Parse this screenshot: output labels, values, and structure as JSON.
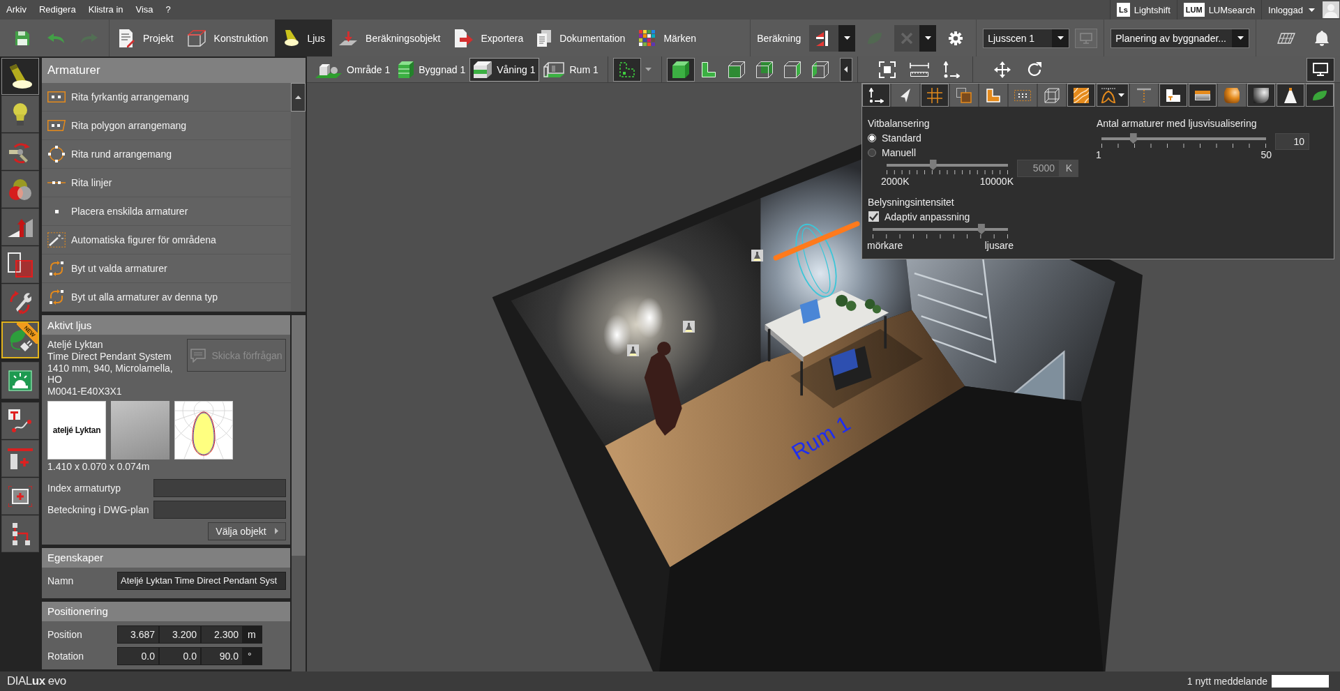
{
  "menu_bar": {
    "items": [
      "Arkiv",
      "Redigera",
      "Klistra in",
      "Visa",
      "?"
    ],
    "services": [
      {
        "logo": "Ls",
        "label": "Lightshift"
      },
      {
        "logo": "LUM",
        "label": "LUMsearch"
      }
    ],
    "account": "Inloggad"
  },
  "toolbar": {
    "quick_actions": [
      {
        "disabled": false
      },
      {
        "disabled": false
      },
      {
        "disabled": true
      }
    ],
    "tabs": [
      {
        "label": "Projekt",
        "selected": false
      },
      {
        "label": "Konstruktion",
        "selected": false
      },
      {
        "label": "Ljus",
        "selected": true
      },
      {
        "label": "Beräkningsobjekt",
        "selected": false
      },
      {
        "label": "Exportera",
        "selected": false
      },
      {
        "label": "Dokumentation",
        "selected": false
      },
      {
        "label": "Märken",
        "selected": false
      }
    ],
    "calculation": {
      "label": "Beräkning",
      "buttons": [
        {
          "disabled": false,
          "dropdown": true
        },
        {
          "disabled": true,
          "dropdown": false
        },
        {
          "disabled": true,
          "dropdown": true
        },
        {
          "disabled": false,
          "dropdown": false
        }
      ]
    },
    "light_scene": {
      "value": "Ljusscen 1",
      "preview_button": {
        "disabled": true
      }
    },
    "workflow": {
      "value": "Planering av byggnader..."
    }
  },
  "side_rail": {
    "groups": [
      {
        "items": [
          {
            "selected": true,
            "highlighted": false
          },
          {
            "selected": false,
            "highlighted": false
          },
          {
            "selected": false,
            "highlighted": false
          },
          {
            "selected": false,
            "highlighted": false
          },
          {
            "selected": false,
            "highlighted": false
          },
          {
            "selected": false,
            "highlighted": false
          },
          {
            "selected": false,
            "highlighted": false
          },
          {
            "selected": false,
            "highlighted": true,
            "badge": "NEW"
          }
        ]
      },
      {
        "items": [
          {
            "selected": false,
            "highlighted": false
          }
        ]
      },
      {
        "items": [
          {
            "selected": false,
            "highlighted": false
          },
          {
            "selected": false,
            "highlighted": false
          },
          {
            "selected": false,
            "highlighted": false
          },
          {
            "selected": false,
            "highlighted": false
          }
        ]
      }
    ]
  },
  "luminaires": {
    "title": "Armaturer",
    "tools": [
      "Rita fyrkantig arrangemang",
      "Rita polygon arrangemang",
      "Rita rund arrangemang",
      "Rita linjer",
      "Placera enskilda armaturer",
      "Automatiska figurer för områdena",
      "Byt ut valda armaturer",
      "Byt ut alla armaturer av denna typ"
    ]
  },
  "active_light": {
    "title": "Aktivt ljus",
    "manufacturer": "Ateljé Lyktan",
    "product": "Time Direct Pendant System",
    "variant": "1410 mm, 940, Microlamella, HO",
    "article": "M0041-E40X3X1",
    "request_button": {
      "label": "Skicka förfrågan",
      "disabled": true
    },
    "brand_logo": "ateljé Lyktan",
    "dimensions": "1.410 x 0.070 x 0.074m",
    "fields": [
      {
        "label": "Index armaturtyp"
      },
      {
        "label": "Beteckning i DWG-plan"
      }
    ],
    "select_button": "Välja objekt"
  },
  "properties": {
    "title": "Egenskaper",
    "fields": [
      {
        "label": "Namn",
        "value": "Ateljé Lyktan Time Direct Pendant Syst"
      }
    ]
  },
  "positioning": {
    "title": "Positionering",
    "rows": [
      {
        "label": "Position",
        "values": [
          "3.687",
          "3.200",
          "2.300"
        ],
        "unit": "m"
      },
      {
        "label": "Rotation",
        "values": [
          "0.0",
          "0.0",
          "90.0"
        ],
        "unit": "°"
      }
    ]
  },
  "view_toolbar": {
    "breadcrumb": [
      {
        "label": "Område 1",
        "selected": false
      },
      {
        "label": "Byggnad 1",
        "selected": false
      },
      {
        "label": "Våning 1",
        "selected": true
      },
      {
        "label": "Rum 1",
        "selected": false
      }
    ],
    "plan_view": {
      "selected": true
    },
    "view_modes": [
      {
        "selected": true
      },
      {
        "selected": false
      },
      {
        "selected": false
      },
      {
        "selected": false
      },
      {
        "selected": false
      },
      {
        "selected": false
      }
    ],
    "display_button": {
      "selected": true
    }
  },
  "scene": {
    "room_label": "Rum 1"
  },
  "display_panel": {
    "toggles": [
      {
        "on": true,
        "dropdown": false
      },
      {
        "on": false,
        "dropdown": false
      },
      {
        "on": true,
        "dropdown": false
      },
      {
        "on": false,
        "dropdown": false
      },
      {
        "on": false,
        "dropdown": false
      },
      {
        "on": false,
        "dropdown": false
      },
      {
        "on": false,
        "dropdown": false
      },
      {
        "on": true,
        "dropdown": false
      },
      {
        "on": true,
        "dropdown": true
      },
      {
        "on": false,
        "dropdown": false
      },
      {
        "on": true,
        "dropdown": false
      },
      {
        "on": true,
        "dropdown": false
      },
      {
        "on": false,
        "dropdown": false
      },
      {
        "on": true,
        "dropdown": false
      },
      {
        "on": true,
        "dropdown": false
      },
      {
        "on": true,
        "dropdown": false
      }
    ],
    "white_balance": {
      "title": "Vitbalansering",
      "options": [
        {
          "label": "Standard",
          "selected": true
        },
        {
          "label": "Manuell",
          "selected": false
        }
      ],
      "slider": {
        "level": 0.375,
        "min_label": "2000K",
        "max_label": "10000K"
      },
      "field": {
        "value": "5000",
        "disabled": true
      },
      "unit": "K"
    },
    "intensity": {
      "title": "Belysningsintensitet",
      "checkbox": {
        "label": "Adaptiv anpassning",
        "checked": true
      },
      "slider": {
        "level": 0.82,
        "min_label": "mörkare",
        "max_label": "ljusare"
      }
    },
    "visualized_luminaires": {
      "title": "Antal armaturer med ljusvisualisering",
      "slider": {
        "level": 0.18,
        "min_label": "1",
        "max_label": "50"
      },
      "value": "10"
    }
  },
  "status_bar": {
    "logo": "DIAL**ux** evo",
    "message": "1 nytt meddelande"
  }
}
